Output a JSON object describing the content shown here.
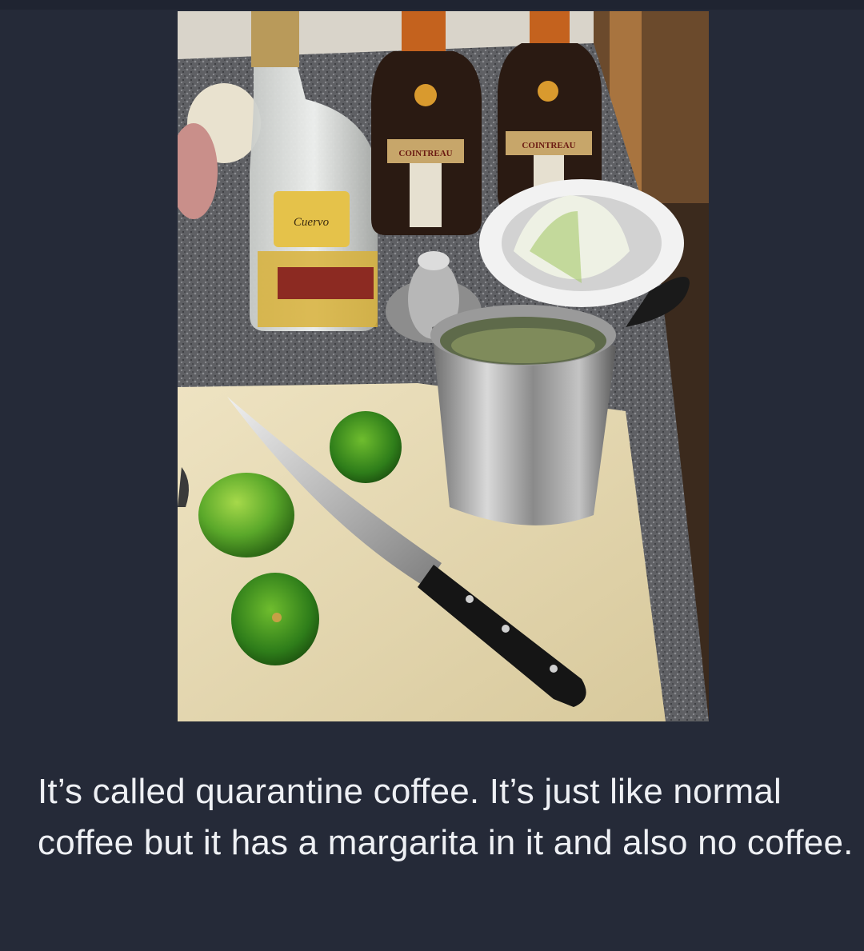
{
  "post": {
    "caption": "It’s called quarantine coffee. It’s just like normal coffee but it has a margarita in it and also no coffee.",
    "photo": {
      "tequila_label": "Cuervo",
      "liqueur_label_left": "COINTREAU",
      "liqueur_label_right": "COINTREAU"
    }
  },
  "colors": {
    "background": "#252a38",
    "caption_text": "#eef0f4",
    "lime": "#5aa82a",
    "cutting_board": "#e8dcb8",
    "countertop": "#6e6e70"
  }
}
